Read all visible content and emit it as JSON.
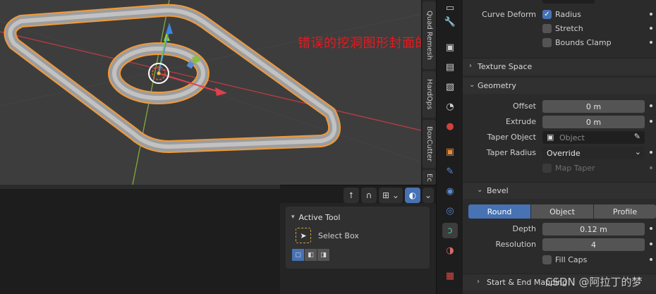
{
  "annotation": "错误的挖洞图形封面的倒角",
  "sidebar_tabs": [
    "Quad Remesh",
    "HardOps",
    "BoxCutter",
    "Ec"
  ],
  "active_tool": {
    "header": "Active Tool",
    "tool_name": "Select Box"
  },
  "properties": {
    "curve_deform": {
      "label": "Curve Deform",
      "radius": {
        "label": "Radius",
        "checked": true
      },
      "stretch": {
        "label": "Stretch",
        "checked": false
      },
      "bounds_clamp": {
        "label": "Bounds Clamp",
        "checked": false
      }
    },
    "texture_space": {
      "title": "Texture Space"
    },
    "geometry": {
      "title": "Geometry",
      "offset": {
        "label": "Offset",
        "value": "0 m"
      },
      "extrude": {
        "label": "Extrude",
        "value": "0 m"
      },
      "taper_object": {
        "label": "Taper Object",
        "placeholder": "Object"
      },
      "taper_radius": {
        "label": "Taper Radius",
        "value": "Override"
      },
      "map_taper": {
        "label": "Map Taper"
      }
    },
    "bevel": {
      "title": "Bevel",
      "modes": [
        "Round",
        "Object",
        "Profile"
      ],
      "selected_mode": "Round",
      "depth": {
        "label": "Depth",
        "value": "0.12 m"
      },
      "resolution": {
        "label": "Resolution",
        "value": "4"
      },
      "fill_caps": {
        "label": "Fill Caps"
      }
    },
    "start_end": {
      "title": "Start & End Mapping"
    }
  },
  "watermark": "CSDN @阿拉丁的梦",
  "colors": {
    "accent": "#4772b3",
    "selection_outline": "#f29a38",
    "annotation": "#e8191e",
    "axis_x": "#e0404e",
    "axis_y": "#8cbf3a"
  }
}
